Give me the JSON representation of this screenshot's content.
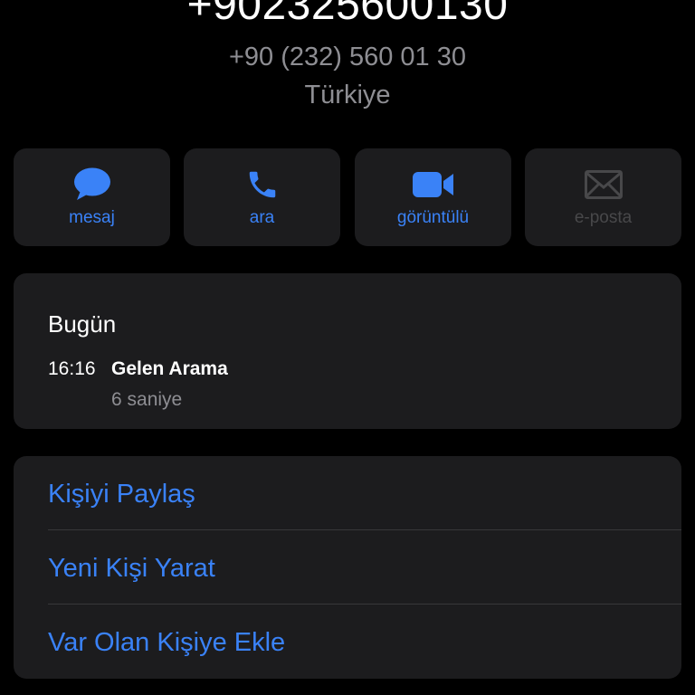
{
  "header": {
    "big_number": "+902325600130",
    "formatted_number": "+90 (232) 560 01 30",
    "country": "Türkiye"
  },
  "actions": [
    {
      "label": "mesaj",
      "icon": "message-bubble-icon",
      "enabled": true
    },
    {
      "label": "ara",
      "icon": "phone-icon",
      "enabled": true
    },
    {
      "label": "görüntülü",
      "icon": "video-camera-icon",
      "enabled": true
    },
    {
      "label": "e-posta",
      "icon": "envelope-icon",
      "enabled": false
    }
  ],
  "recents": {
    "day": "Bugün",
    "entries": [
      {
        "time": "16:16",
        "type": "Gelen Arama",
        "duration": "6 saniye"
      }
    ]
  },
  "options": [
    {
      "label": "Kişiyi Paylaş"
    },
    {
      "label": "Yeni Kişi Yarat"
    },
    {
      "label": "Var Olan Kişiye Ekle"
    }
  ],
  "colors": {
    "background": "#000000",
    "card": "#1c1c1e",
    "accent": "#3a82f7",
    "secondary_text": "#8e8e93",
    "disabled": "#48484a",
    "separator": "#38383a"
  }
}
